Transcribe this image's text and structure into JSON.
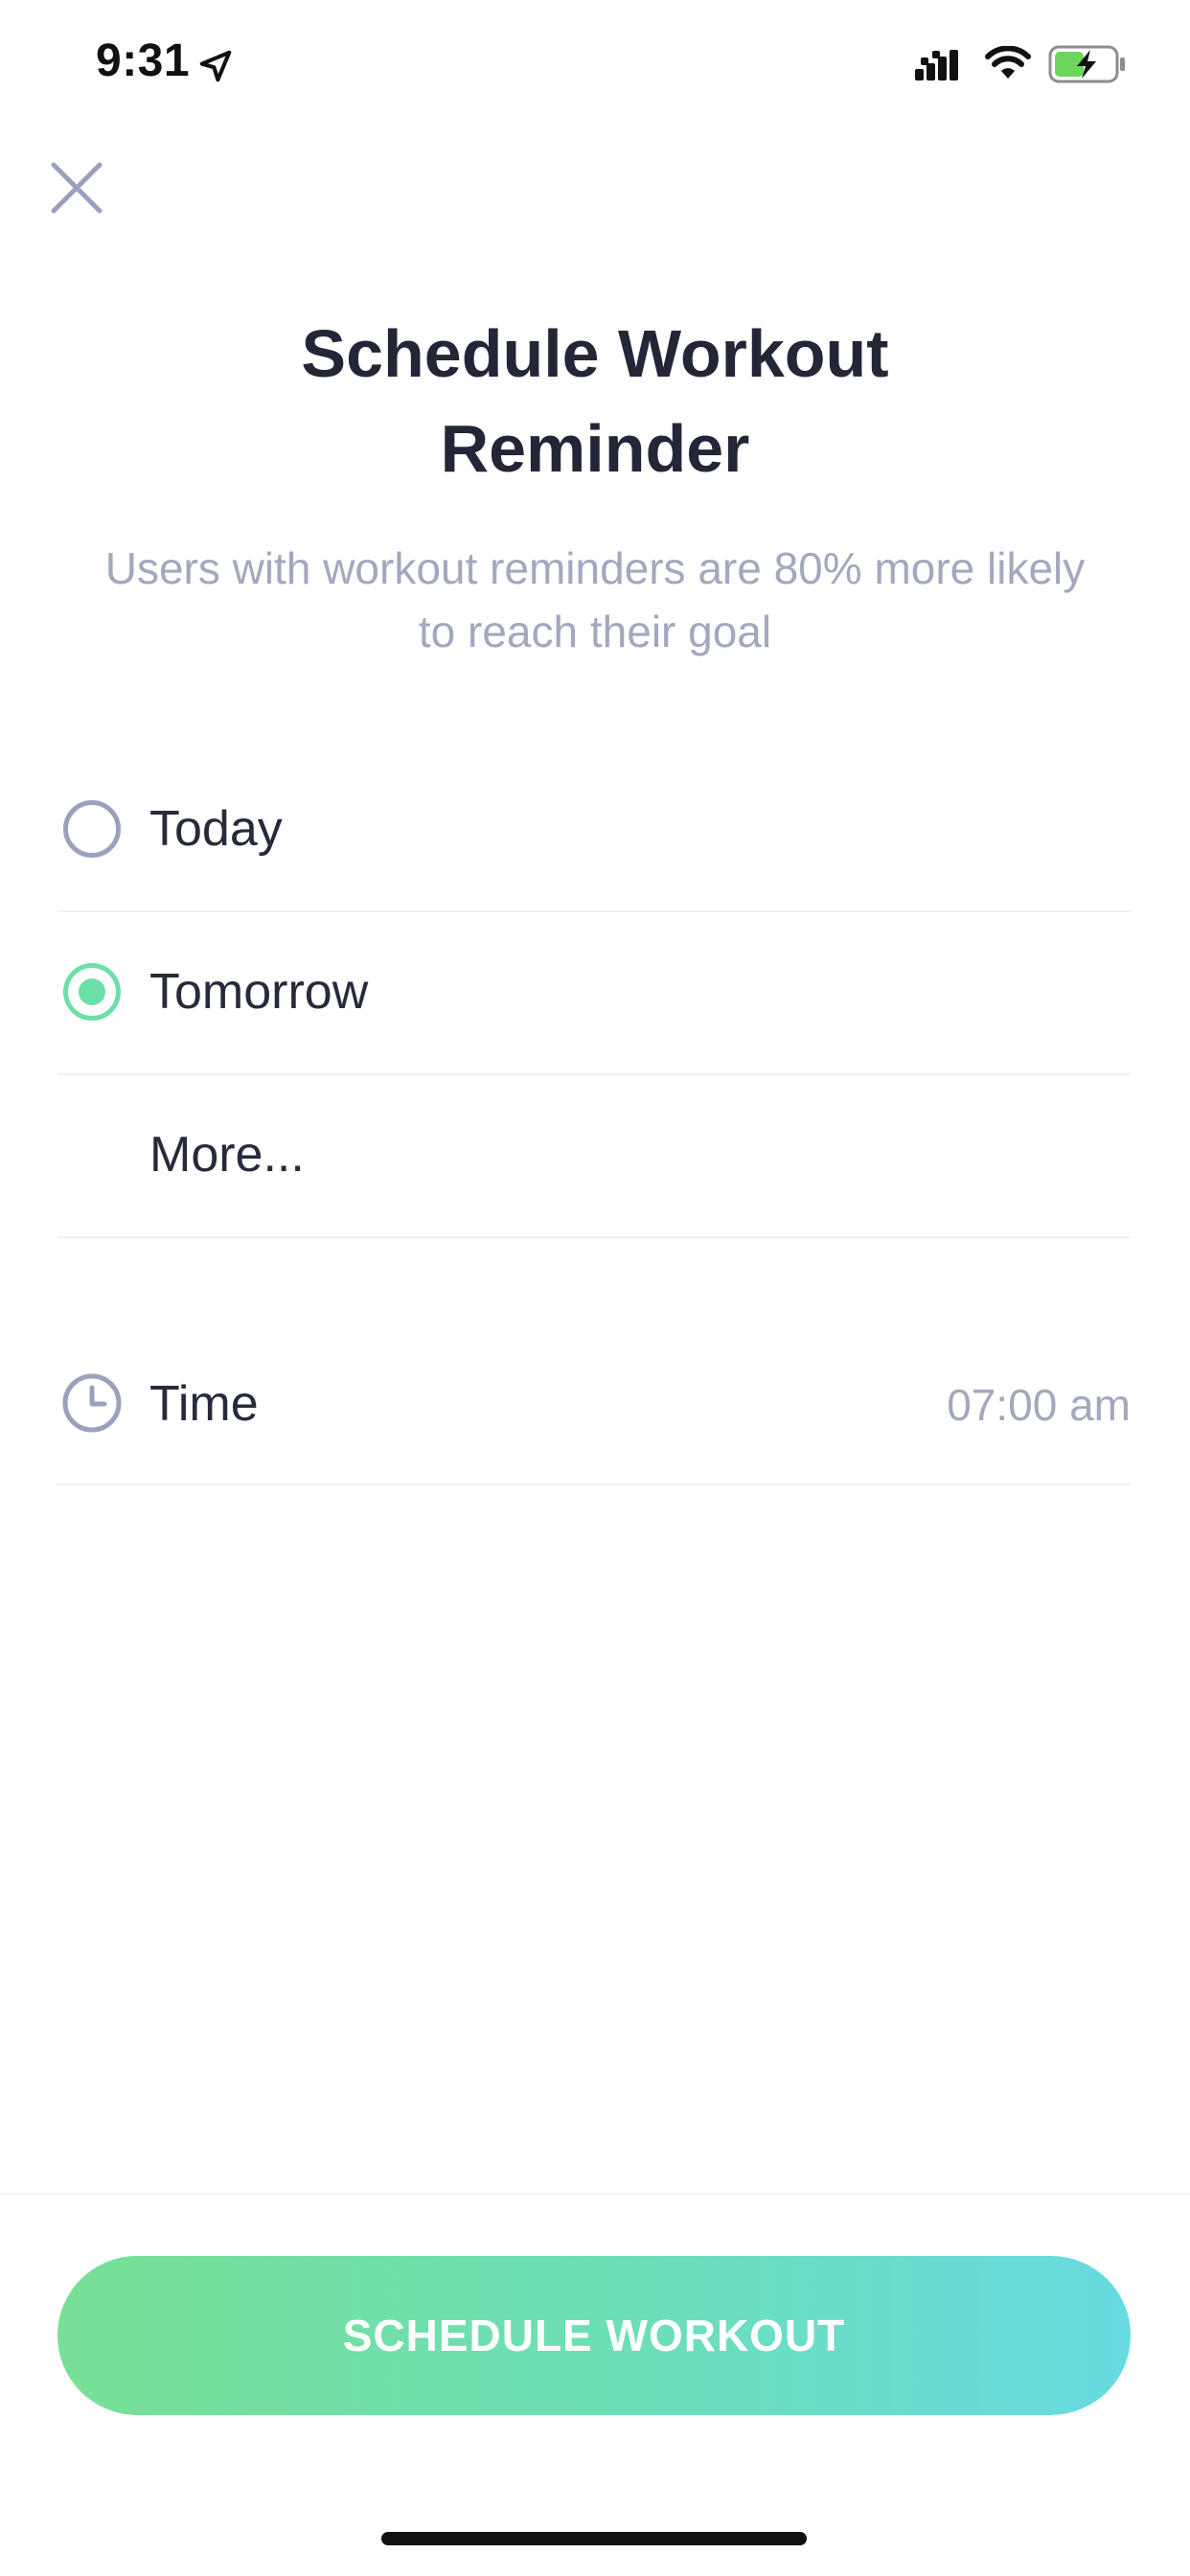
{
  "status_bar": {
    "time": "9:31",
    "icons": [
      "location-arrow-icon",
      "cellular-signal-icon",
      "wifi-icon",
      "battery-charging-icon"
    ],
    "battery_color": "#6cd65a"
  },
  "header": {
    "close_icon": "close-icon",
    "title_line1": "Schedule Workout",
    "title_line2": "Reminder",
    "subtitle_line1": "Users with workout reminders are 80% more likely",
    "subtitle_line2": "to reach their goal"
  },
  "day_options": [
    {
      "label": "Today",
      "selected": false
    },
    {
      "label": "Tomorrow",
      "selected": true
    },
    {
      "label": "More..."
    }
  ],
  "time": {
    "icon": "clock-icon",
    "label": "Time",
    "value": "07:00 am"
  },
  "footer": {
    "button_label": "SCHEDULE WORKOUT"
  },
  "colors": {
    "accent": "#6ddfa8",
    "title": "#232637",
    "muted": "#a3a8bf",
    "gradient_start": "#77e095",
    "gradient_end": "#66dbe1"
  }
}
